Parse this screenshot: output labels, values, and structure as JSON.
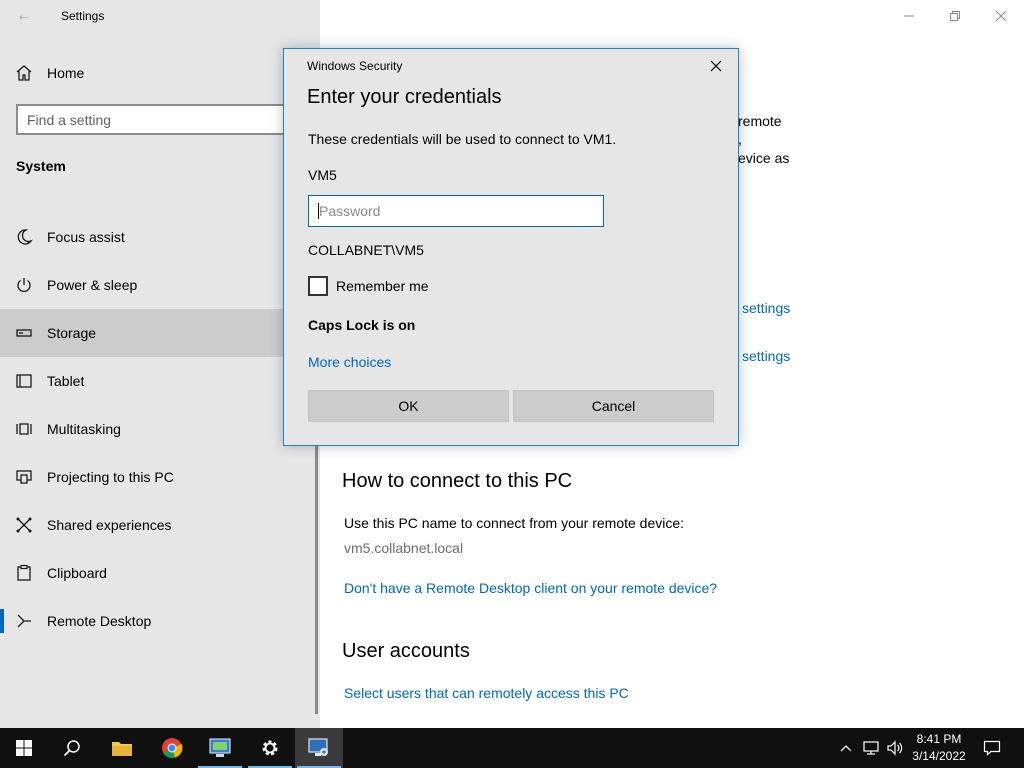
{
  "window": {
    "title": "Settings",
    "back_glyph": "←",
    "controls": {
      "minimize": "minimize-icon",
      "restore": "restore-icon",
      "close": "close-icon"
    }
  },
  "sidebar": {
    "home_label": "Home",
    "search_placeholder": "Find a setting",
    "section_title": "System",
    "items": [
      {
        "label": "Focus assist",
        "icon": "moon-icon"
      },
      {
        "label": "Power & sleep",
        "icon": "power-icon"
      },
      {
        "label": "Storage",
        "icon": "storage-icon",
        "selected": true
      },
      {
        "label": "Tablet",
        "icon": "tablet-icon"
      },
      {
        "label": "Multitasking",
        "icon": "multitasking-icon"
      },
      {
        "label": "Projecting to this PC",
        "icon": "projecting-icon"
      },
      {
        "label": "Shared experiences",
        "icon": "shared-icon"
      },
      {
        "label": "Clipboard",
        "icon": "clipboard-icon"
      },
      {
        "label": "Remote Desktop",
        "icon": "remote-desktop-icon",
        "current": true
      }
    ]
  },
  "content": {
    "peek_lines": [
      "remote",
      ",",
      "evice as"
    ],
    "peek_links": [
      "settings",
      "settings"
    ],
    "connect_heading": "How to connect to this PC",
    "connect_text": "Use this PC name to connect from your remote device:",
    "pc_name": "vm5.collabnet.local",
    "client_link": "Don't have a Remote Desktop client on your remote device?",
    "accounts_heading": "User accounts",
    "accounts_link": "Select users that can remotely access this PC"
  },
  "dialog": {
    "title": "Windows Security",
    "heading": "Enter your credentials",
    "description": "These credentials will be used to connect to VM1.",
    "username": "VM5",
    "password_placeholder": "Password",
    "domain_user": "COLLABNET\\VM5",
    "remember_label": "Remember me",
    "remember_checked": false,
    "caps_warning": "Caps Lock is on",
    "more_choices": "More choices",
    "ok_label": "OK",
    "cancel_label": "Cancel",
    "accent_color": "#1883d7"
  },
  "taskbar": {
    "apps": [
      "start-icon",
      "search-icon",
      "file-explorer-icon",
      "chrome-icon",
      "server-manager-icon",
      "settings-gear-icon",
      "remote-desktop-connection-icon"
    ],
    "tray": [
      "chevron-up-icon",
      "network-icon",
      "volume-icon"
    ],
    "time": "8:41 PM",
    "date": "3/14/2022",
    "notification": "action-center-icon"
  }
}
